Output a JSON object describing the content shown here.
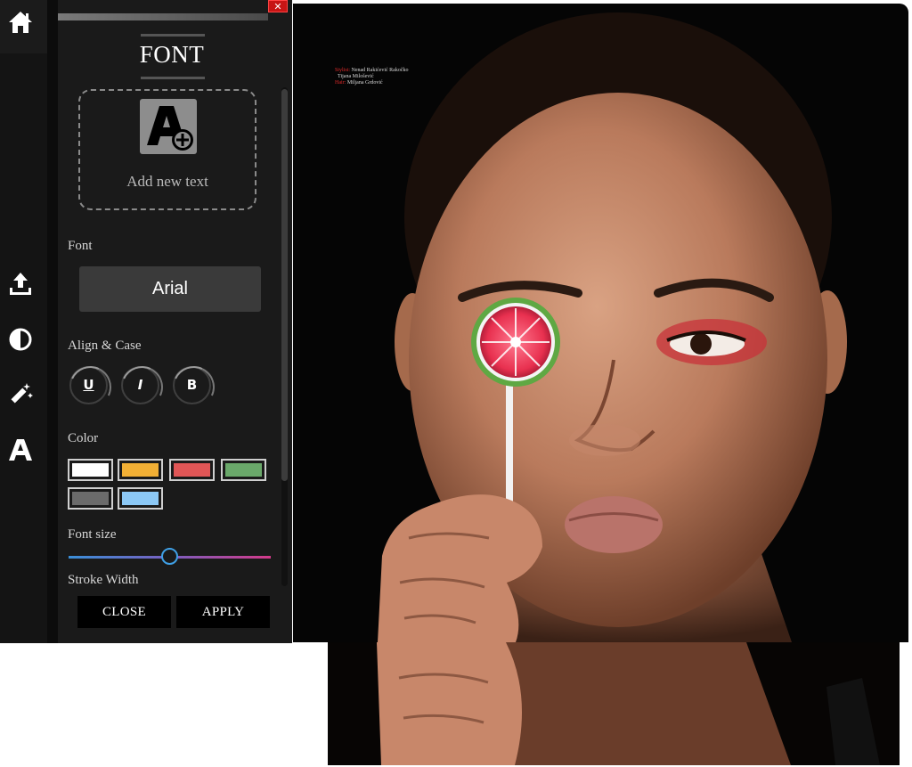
{
  "panel": {
    "title": "FONT",
    "close_glyph": "✕",
    "add_text_label": "Add new text",
    "font": {
      "label": "Font",
      "value": "Arial"
    },
    "align_case": {
      "label": "Align & Case",
      "buttons": [
        {
          "glyph": "U",
          "icon": "underline-icon"
        },
        {
          "glyph": "I",
          "icon": "italic-icon"
        },
        {
          "glyph": "B",
          "icon": "bold-icon"
        }
      ]
    },
    "color": {
      "label": "Color",
      "swatches": [
        "#ffffff",
        "#f2b035",
        "#e05656",
        "#6aa86a",
        "#6b6b6b",
        "#8cc8f5"
      ]
    },
    "font_size": {
      "label": "Font size",
      "value_fraction": 0.5
    },
    "stroke_width": {
      "label": "Stroke Width"
    },
    "footer": {
      "close_label": "CLOSE",
      "apply_label": "APPLY"
    }
  },
  "rail": {
    "icons": [
      "home-icon",
      "upload-icon",
      "contrast-icon",
      "magic-wand-icon",
      "text-icon"
    ]
  },
  "photo": {
    "credits": [
      {
        "key": "Stylist:",
        "value": "Nenad Rakićević Rakočko"
      },
      {
        "key": "",
        "value": "Tijana Milošević"
      },
      {
        "key": "Hair:",
        "value": "Miljana Grdović"
      }
    ]
  },
  "colors": {
    "panel_bg": "#1a1a1a",
    "rail_bg": "#141414",
    "accent_slider": "#3fa0e6",
    "close_red": "#c71515"
  }
}
